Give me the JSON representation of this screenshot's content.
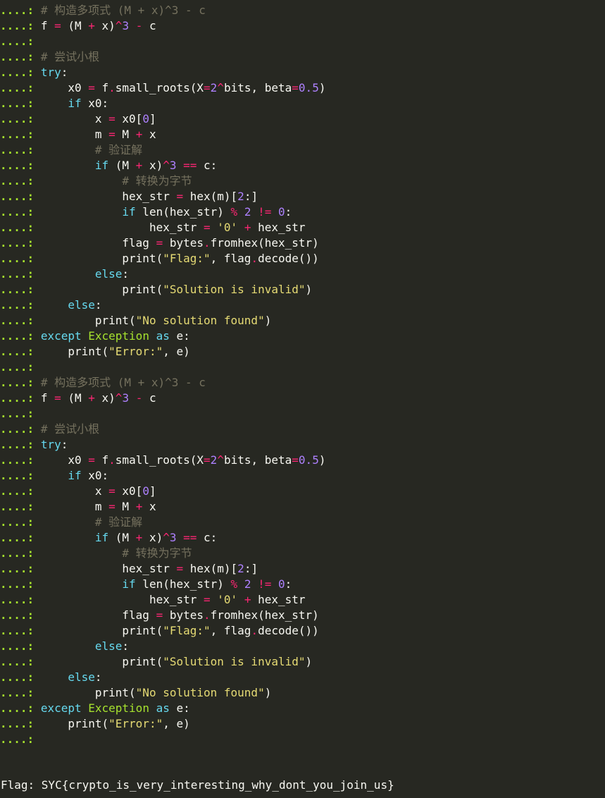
{
  "colors": {
    "background": "#272822",
    "text": "#f8f8f2",
    "prompt": "#a6e22e",
    "comment": "#75715e",
    "keyword": "#66d9ef",
    "operator": "#f92672",
    "number": "#ae81ff",
    "string": "#e6db74",
    "builtin_class": "#a6e22e"
  },
  "prompt": "....:",
  "lines": [
    [
      [
        "#75715e",
        "# 构造多项式 (M + x)^3 - c"
      ]
    ],
    [
      [
        "#f8f8f2",
        "f "
      ],
      [
        "#f92672",
        "="
      ],
      [
        "#f8f8f2",
        " (M "
      ],
      [
        "#f92672",
        "+"
      ],
      [
        "#f8f8f2",
        " x)"
      ],
      [
        "#f92672",
        "^"
      ],
      [
        "#ae81ff",
        "3"
      ],
      [
        "#f8f8f2",
        " "
      ],
      [
        "#f92672",
        "-"
      ],
      [
        "#f8f8f2",
        " c"
      ]
    ],
    [],
    [
      [
        "#75715e",
        "# 尝试小根"
      ]
    ],
    [
      [
        "#66d9ef",
        "try"
      ],
      [
        "#f8f8f2",
        ":"
      ]
    ],
    [
      [
        "#f8f8f2",
        "    x0 "
      ],
      [
        "#f92672",
        "="
      ],
      [
        "#f8f8f2",
        " f"
      ],
      [
        "#f92672",
        "."
      ],
      [
        "#f8f8f2",
        "small_roots(X"
      ],
      [
        "#f92672",
        "="
      ],
      [
        "#ae81ff",
        "2"
      ],
      [
        "#f92672",
        "^"
      ],
      [
        "#f8f8f2",
        "bits, beta"
      ],
      [
        "#f92672",
        "="
      ],
      [
        "#ae81ff",
        "0.5"
      ],
      [
        "#f8f8f2",
        ")"
      ]
    ],
    [
      [
        "#f8f8f2",
        "    "
      ],
      [
        "#66d9ef",
        "if"
      ],
      [
        "#f8f8f2",
        " x0:"
      ]
    ],
    [
      [
        "#f8f8f2",
        "        x "
      ],
      [
        "#f92672",
        "="
      ],
      [
        "#f8f8f2",
        " x0["
      ],
      [
        "#ae81ff",
        "0"
      ],
      [
        "#f8f8f2",
        "]"
      ]
    ],
    [
      [
        "#f8f8f2",
        "        m "
      ],
      [
        "#f92672",
        "="
      ],
      [
        "#f8f8f2",
        " M "
      ],
      [
        "#f92672",
        "+"
      ],
      [
        "#f8f8f2",
        " x"
      ]
    ],
    [
      [
        "#f8f8f2",
        "        "
      ],
      [
        "#75715e",
        "# 验证解"
      ]
    ],
    [
      [
        "#f8f8f2",
        "        "
      ],
      [
        "#66d9ef",
        "if"
      ],
      [
        "#f8f8f2",
        " (M "
      ],
      [
        "#f92672",
        "+"
      ],
      [
        "#f8f8f2",
        " x)"
      ],
      [
        "#f92672",
        "^"
      ],
      [
        "#ae81ff",
        "3"
      ],
      [
        "#f8f8f2",
        " "
      ],
      [
        "#f92672",
        "=="
      ],
      [
        "#f8f8f2",
        " c:"
      ]
    ],
    [
      [
        "#f8f8f2",
        "            "
      ],
      [
        "#75715e",
        "# 转换为字节"
      ]
    ],
    [
      [
        "#f8f8f2",
        "            hex_str "
      ],
      [
        "#f92672",
        "="
      ],
      [
        "#f8f8f2",
        " hex(m)["
      ],
      [
        "#ae81ff",
        "2"
      ],
      [
        "#f8f8f2",
        ":]"
      ]
    ],
    [
      [
        "#f8f8f2",
        "            "
      ],
      [
        "#66d9ef",
        "if"
      ],
      [
        "#f8f8f2",
        " len(hex_str) "
      ],
      [
        "#f92672",
        "%"
      ],
      [
        "#f8f8f2",
        " "
      ],
      [
        "#ae81ff",
        "2"
      ],
      [
        "#f8f8f2",
        " "
      ],
      [
        "#f92672",
        "!="
      ],
      [
        "#f8f8f2",
        " "
      ],
      [
        "#ae81ff",
        "0"
      ],
      [
        "#f8f8f2",
        ":"
      ]
    ],
    [
      [
        "#f8f8f2",
        "                hex_str "
      ],
      [
        "#f92672",
        "="
      ],
      [
        "#f8f8f2",
        " "
      ],
      [
        "#e6db74",
        "'0'"
      ],
      [
        "#f8f8f2",
        " "
      ],
      [
        "#f92672",
        "+"
      ],
      [
        "#f8f8f2",
        " hex_str"
      ]
    ],
    [
      [
        "#f8f8f2",
        "            flag "
      ],
      [
        "#f92672",
        "="
      ],
      [
        "#f8f8f2",
        " bytes"
      ],
      [
        "#f92672",
        "."
      ],
      [
        "#f8f8f2",
        "fromhex(hex_str)"
      ]
    ],
    [
      [
        "#f8f8f2",
        "            print("
      ],
      [
        "#e6db74",
        "\"Flag:\""
      ],
      [
        "#f8f8f2",
        ", flag"
      ],
      [
        "#f92672",
        "."
      ],
      [
        "#f8f8f2",
        "decode())"
      ]
    ],
    [
      [
        "#f8f8f2",
        "        "
      ],
      [
        "#66d9ef",
        "else"
      ],
      [
        "#f8f8f2",
        ":"
      ]
    ],
    [
      [
        "#f8f8f2",
        "            print("
      ],
      [
        "#e6db74",
        "\"Solution is invalid\""
      ],
      [
        "#f8f8f2",
        ")"
      ]
    ],
    [
      [
        "#f8f8f2",
        "    "
      ],
      [
        "#66d9ef",
        "else"
      ],
      [
        "#f8f8f2",
        ":"
      ]
    ],
    [
      [
        "#f8f8f2",
        "        print("
      ],
      [
        "#e6db74",
        "\"No solution found\""
      ],
      [
        "#f8f8f2",
        ")"
      ]
    ],
    [
      [
        "#66d9ef",
        "except"
      ],
      [
        "#f8f8f2",
        " "
      ],
      [
        "#a6e22e",
        "Exception"
      ],
      [
        "#f8f8f2",
        " "
      ],
      [
        "#66d9ef",
        "as"
      ],
      [
        "#f8f8f2",
        " e:"
      ]
    ],
    [
      [
        "#f8f8f2",
        "    print("
      ],
      [
        "#e6db74",
        "\"Error:\""
      ],
      [
        "#f8f8f2",
        ", e)"
      ]
    ],
    [],
    [
      [
        "#75715e",
        "# 构造多项式 (M + x)^3 - c"
      ]
    ],
    [
      [
        "#f8f8f2",
        "f "
      ],
      [
        "#f92672",
        "="
      ],
      [
        "#f8f8f2",
        " (M "
      ],
      [
        "#f92672",
        "+"
      ],
      [
        "#f8f8f2",
        " x)"
      ],
      [
        "#f92672",
        "^"
      ],
      [
        "#ae81ff",
        "3"
      ],
      [
        "#f8f8f2",
        " "
      ],
      [
        "#f92672",
        "-"
      ],
      [
        "#f8f8f2",
        " c"
      ]
    ],
    [],
    [
      [
        "#75715e",
        "# 尝试小根"
      ]
    ],
    [
      [
        "#66d9ef",
        "try"
      ],
      [
        "#f8f8f2",
        ":"
      ]
    ],
    [
      [
        "#f8f8f2",
        "    x0 "
      ],
      [
        "#f92672",
        "="
      ],
      [
        "#f8f8f2",
        " f"
      ],
      [
        "#f92672",
        "."
      ],
      [
        "#f8f8f2",
        "small_roots(X"
      ],
      [
        "#f92672",
        "="
      ],
      [
        "#ae81ff",
        "2"
      ],
      [
        "#f92672",
        "^"
      ],
      [
        "#f8f8f2",
        "bits, beta"
      ],
      [
        "#f92672",
        "="
      ],
      [
        "#ae81ff",
        "0.5"
      ],
      [
        "#f8f8f2",
        ")"
      ]
    ],
    [
      [
        "#f8f8f2",
        "    "
      ],
      [
        "#66d9ef",
        "if"
      ],
      [
        "#f8f8f2",
        " x0:"
      ]
    ],
    [
      [
        "#f8f8f2",
        "        x "
      ],
      [
        "#f92672",
        "="
      ],
      [
        "#f8f8f2",
        " x0["
      ],
      [
        "#ae81ff",
        "0"
      ],
      [
        "#f8f8f2",
        "]"
      ]
    ],
    [
      [
        "#f8f8f2",
        "        m "
      ],
      [
        "#f92672",
        "="
      ],
      [
        "#f8f8f2",
        " M "
      ],
      [
        "#f92672",
        "+"
      ],
      [
        "#f8f8f2",
        " x"
      ]
    ],
    [
      [
        "#f8f8f2",
        "        "
      ],
      [
        "#75715e",
        "# 验证解"
      ]
    ],
    [
      [
        "#f8f8f2",
        "        "
      ],
      [
        "#66d9ef",
        "if"
      ],
      [
        "#f8f8f2",
        " (M "
      ],
      [
        "#f92672",
        "+"
      ],
      [
        "#f8f8f2",
        " x)"
      ],
      [
        "#f92672",
        "^"
      ],
      [
        "#ae81ff",
        "3"
      ],
      [
        "#f8f8f2",
        " "
      ],
      [
        "#f92672",
        "=="
      ],
      [
        "#f8f8f2",
        " c:"
      ]
    ],
    [
      [
        "#f8f8f2",
        "            "
      ],
      [
        "#75715e",
        "# 转换为字节"
      ]
    ],
    [
      [
        "#f8f8f2",
        "            hex_str "
      ],
      [
        "#f92672",
        "="
      ],
      [
        "#f8f8f2",
        " hex(m)["
      ],
      [
        "#ae81ff",
        "2"
      ],
      [
        "#f8f8f2",
        ":]"
      ]
    ],
    [
      [
        "#f8f8f2",
        "            "
      ],
      [
        "#66d9ef",
        "if"
      ],
      [
        "#f8f8f2",
        " len(hex_str) "
      ],
      [
        "#f92672",
        "%"
      ],
      [
        "#f8f8f2",
        " "
      ],
      [
        "#ae81ff",
        "2"
      ],
      [
        "#f8f8f2",
        " "
      ],
      [
        "#f92672",
        "!="
      ],
      [
        "#f8f8f2",
        " "
      ],
      [
        "#ae81ff",
        "0"
      ],
      [
        "#f8f8f2",
        ":"
      ]
    ],
    [
      [
        "#f8f8f2",
        "                hex_str "
      ],
      [
        "#f92672",
        "="
      ],
      [
        "#f8f8f2",
        " "
      ],
      [
        "#e6db74",
        "'0'"
      ],
      [
        "#f8f8f2",
        " "
      ],
      [
        "#f92672",
        "+"
      ],
      [
        "#f8f8f2",
        " hex_str"
      ]
    ],
    [
      [
        "#f8f8f2",
        "            flag "
      ],
      [
        "#f92672",
        "="
      ],
      [
        "#f8f8f2",
        " bytes"
      ],
      [
        "#f92672",
        "."
      ],
      [
        "#f8f8f2",
        "fromhex(hex_str)"
      ]
    ],
    [
      [
        "#f8f8f2",
        "            print("
      ],
      [
        "#e6db74",
        "\"Flag:\""
      ],
      [
        "#f8f8f2",
        ", flag"
      ],
      [
        "#f92672",
        "."
      ],
      [
        "#f8f8f2",
        "decode())"
      ]
    ],
    [
      [
        "#f8f8f2",
        "        "
      ],
      [
        "#66d9ef",
        "else"
      ],
      [
        "#f8f8f2",
        ":"
      ]
    ],
    [
      [
        "#f8f8f2",
        "            print("
      ],
      [
        "#e6db74",
        "\"Solution is invalid\""
      ],
      [
        "#f8f8f2",
        ")"
      ]
    ],
    [
      [
        "#f8f8f2",
        "    "
      ],
      [
        "#66d9ef",
        "else"
      ],
      [
        "#f8f8f2",
        ":"
      ]
    ],
    [
      [
        "#f8f8f2",
        "        print("
      ],
      [
        "#e6db74",
        "\"No solution found\""
      ],
      [
        "#f8f8f2",
        ")"
      ]
    ],
    [
      [
        "#66d9ef",
        "except"
      ],
      [
        "#f8f8f2",
        " "
      ],
      [
        "#a6e22e",
        "Exception"
      ],
      [
        "#f8f8f2",
        " "
      ],
      [
        "#66d9ef",
        "as"
      ],
      [
        "#f8f8f2",
        " e:"
      ]
    ],
    [
      [
        "#f8f8f2",
        "    print("
      ],
      [
        "#e6db74",
        "\"Error:\""
      ],
      [
        "#f8f8f2",
        ", e)"
      ]
    ],
    []
  ],
  "output": {
    "flag_line": "Flag: SYC{crypto_is_very_interesting_why_dont_you_join_us}"
  }
}
